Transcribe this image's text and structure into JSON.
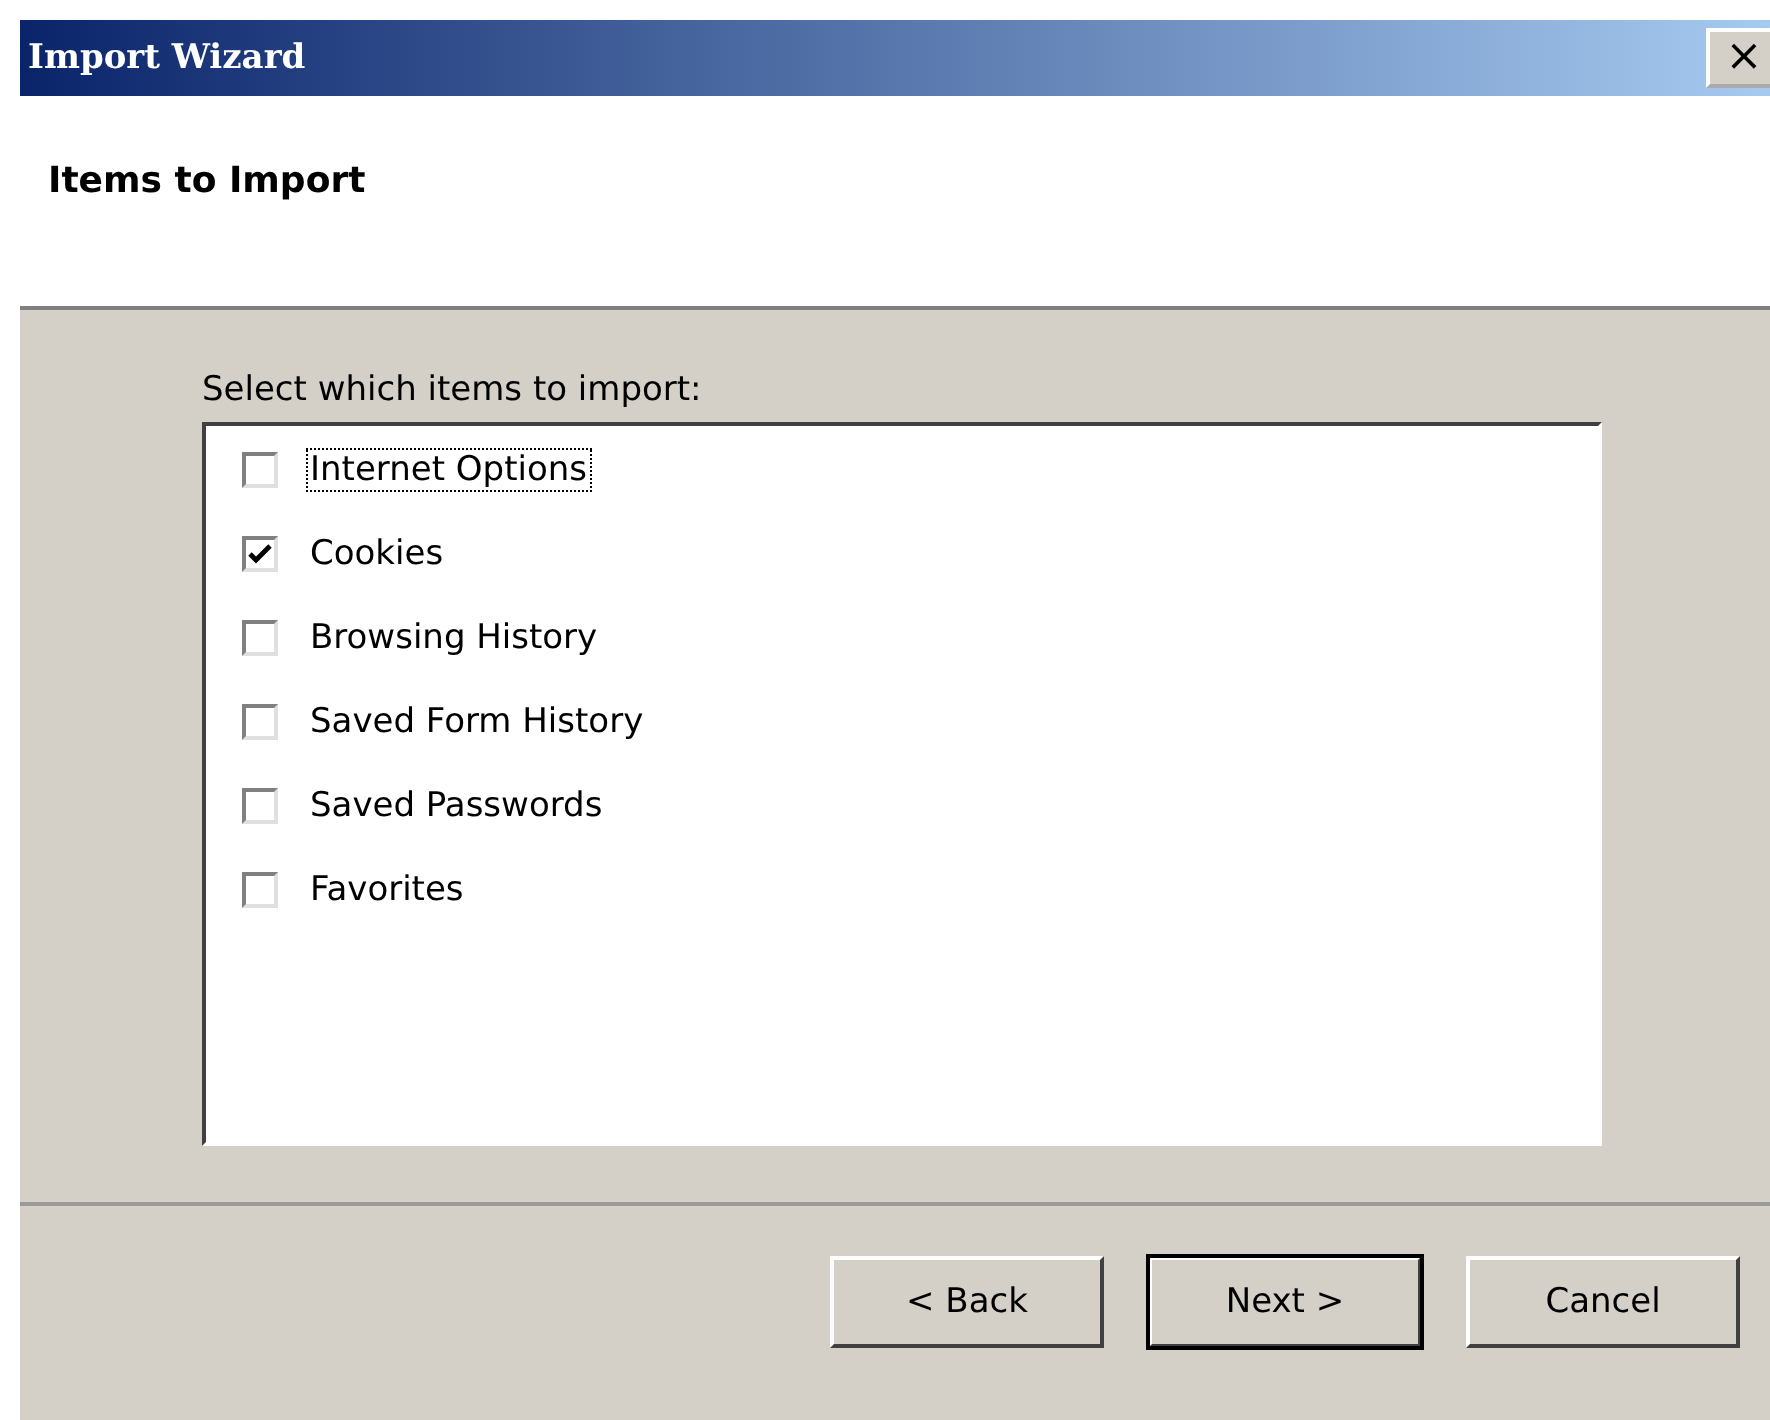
{
  "window": {
    "title": "Import Wizard",
    "close": "×"
  },
  "header": {
    "title": "Items to Import"
  },
  "prompt": "Select which items to import:",
  "items": [
    {
      "label": "Internet Options",
      "checked": false,
      "focused": true
    },
    {
      "label": "Cookies",
      "checked": true,
      "focused": false
    },
    {
      "label": "Browsing History",
      "checked": false,
      "focused": false
    },
    {
      "label": "Saved Form History",
      "checked": false,
      "focused": false
    },
    {
      "label": "Saved Passwords",
      "checked": false,
      "focused": false
    },
    {
      "label": "Favorites",
      "checked": false,
      "focused": false
    }
  ],
  "buttons": [
    {
      "label": "< Back",
      "default": false
    },
    {
      "label": "Next >",
      "default": true
    },
    {
      "label": "Cancel",
      "default": false
    }
  ]
}
